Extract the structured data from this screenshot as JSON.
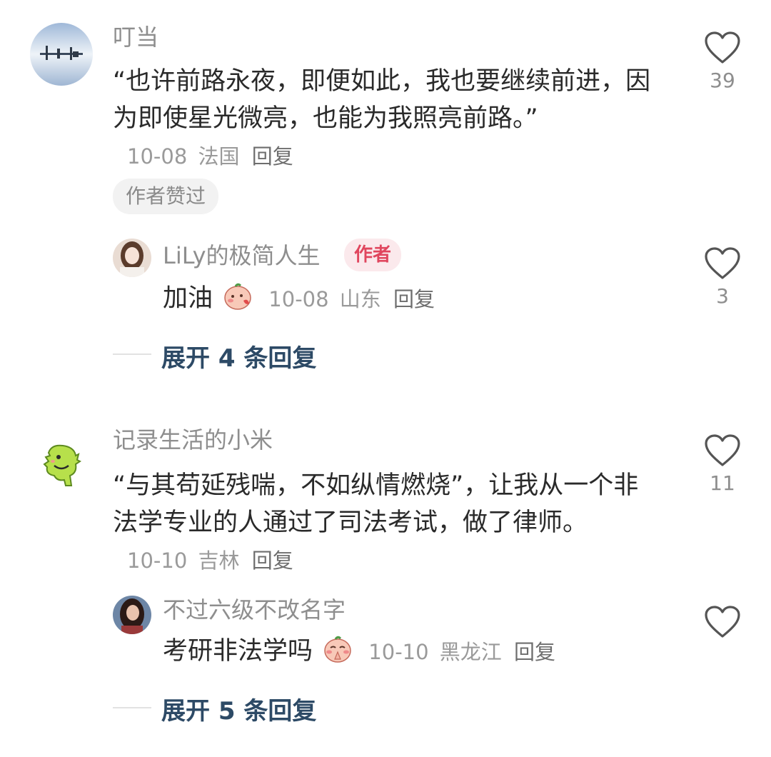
{
  "comments": [
    {
      "user": "叮当",
      "text": "“也许前路永夜，即便如此，我也要继续前进，因为即使星光微亮，也能为我照亮前路。”",
      "date": "10-08",
      "location": "法国",
      "reply": "回复",
      "tag": "作者赞过",
      "likes": "39",
      "sub_reply": {
        "user": "LiLy的极简人生",
        "badge": "作者",
        "text": "加油",
        "date": "10-08",
        "location": "山东",
        "reply": "回复",
        "likes": "3"
      },
      "expand": "展开 4 条回复"
    },
    {
      "user": "记录生活的小米",
      "text": "“与其苟延残喘，不如纵情燃烧”，让我从一个非法学专业的人通过了司法考试，做了律师。",
      "date": "10-10",
      "location": "吉林",
      "reply": "回复",
      "likes": "11",
      "sub_reply": {
        "user": "不过六级不改名字",
        "text": "考研非法学吗",
        "date": "10-10",
        "location": "黑龙江",
        "reply": "回复",
        "likes": ""
      },
      "expand": "展开 5 条回复"
    }
  ]
}
